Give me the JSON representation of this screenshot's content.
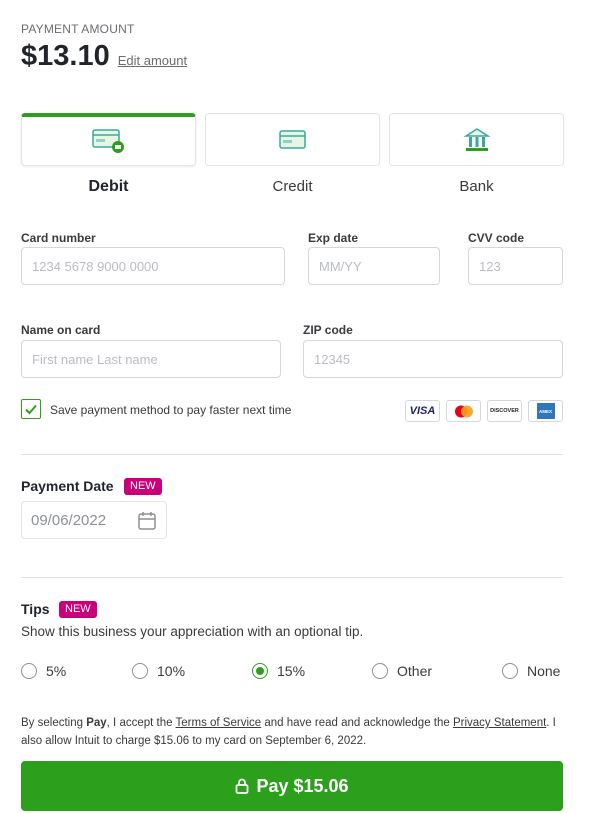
{
  "payment": {
    "amount_label": "PAYMENT AMOUNT",
    "amount": "$13.10",
    "edit_label": "Edit amount"
  },
  "methods": [
    {
      "label": "Debit",
      "icon": "debit-card-icon",
      "selected": true
    },
    {
      "label": "Credit",
      "icon": "credit-card-icon",
      "selected": false
    },
    {
      "label": "Bank",
      "icon": "bank-icon",
      "selected": false
    }
  ],
  "form": {
    "card_number_label": "Card number",
    "card_number_placeholder": "1234 5678 9000 0000",
    "exp_label": "Exp date",
    "exp_placeholder": "MM/YY",
    "cvv_label": "CVV code",
    "cvv_placeholder": "123",
    "name_label": "Name on card",
    "name_placeholder": "First name Last name",
    "zip_label": "ZIP code",
    "zip_placeholder": "12345",
    "save_label": "Save payment method to pay faster next time",
    "save_checked": true
  },
  "card_logos": [
    "VISA",
    "mastercard",
    "DISCOVER",
    "AMEX"
  ],
  "payment_date": {
    "title": "Payment Date",
    "badge": "NEW",
    "value": "09/06/2022"
  },
  "tips": {
    "title": "Tips",
    "badge": "NEW",
    "description": "Show this business your appreciation with an optional tip.",
    "options": [
      "5%",
      "10%",
      "15%",
      "Other",
      "None"
    ],
    "selected": "15%"
  },
  "legal": {
    "part1": "By selecting ",
    "pay_word": "Pay",
    "part2": ", I accept the ",
    "terms": "Terms of Service",
    "part3": " and have read and acknowledge the ",
    "privacy": "Privacy Statement",
    "part4": ". I also allow Intuit to charge $15.06 to my card on September 6, 2022."
  },
  "pay_button": "Pay $15.06",
  "colors": {
    "accent": "#2ca01c",
    "badge": "#c9007a"
  }
}
